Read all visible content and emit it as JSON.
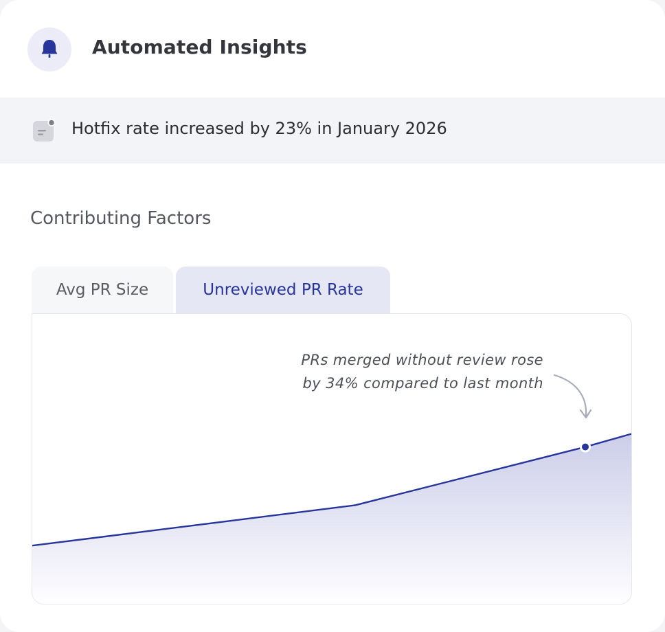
{
  "header": {
    "title": "Automated Insights",
    "icon": "bell-icon"
  },
  "insight": {
    "icon": "note-icon",
    "text": "Hotfix rate increased by 23% in January 2026"
  },
  "section": {
    "title": "Contributing Factors"
  },
  "tabs": [
    {
      "label": "Avg PR Size",
      "active": false
    },
    {
      "label": "Unreviewed PR Rate",
      "active": true
    }
  ],
  "chart": {
    "annotation_line1": "PRs merged without review rose",
    "annotation_line2": "by 34% compared to last month"
  },
  "colors": {
    "accent": "#26349b",
    "tab_active_bg": "#e6e7f4",
    "insight_bg": "#f3f4f8"
  },
  "chart_data": {
    "type": "area",
    "series": [
      {
        "values": [
          18,
          36,
          62,
          68
        ]
      }
    ],
    "highlighted_point_index": 2,
    "title": "",
    "xlabel": "",
    "ylabel": "",
    "ylim": [
      0,
      100
    ]
  }
}
